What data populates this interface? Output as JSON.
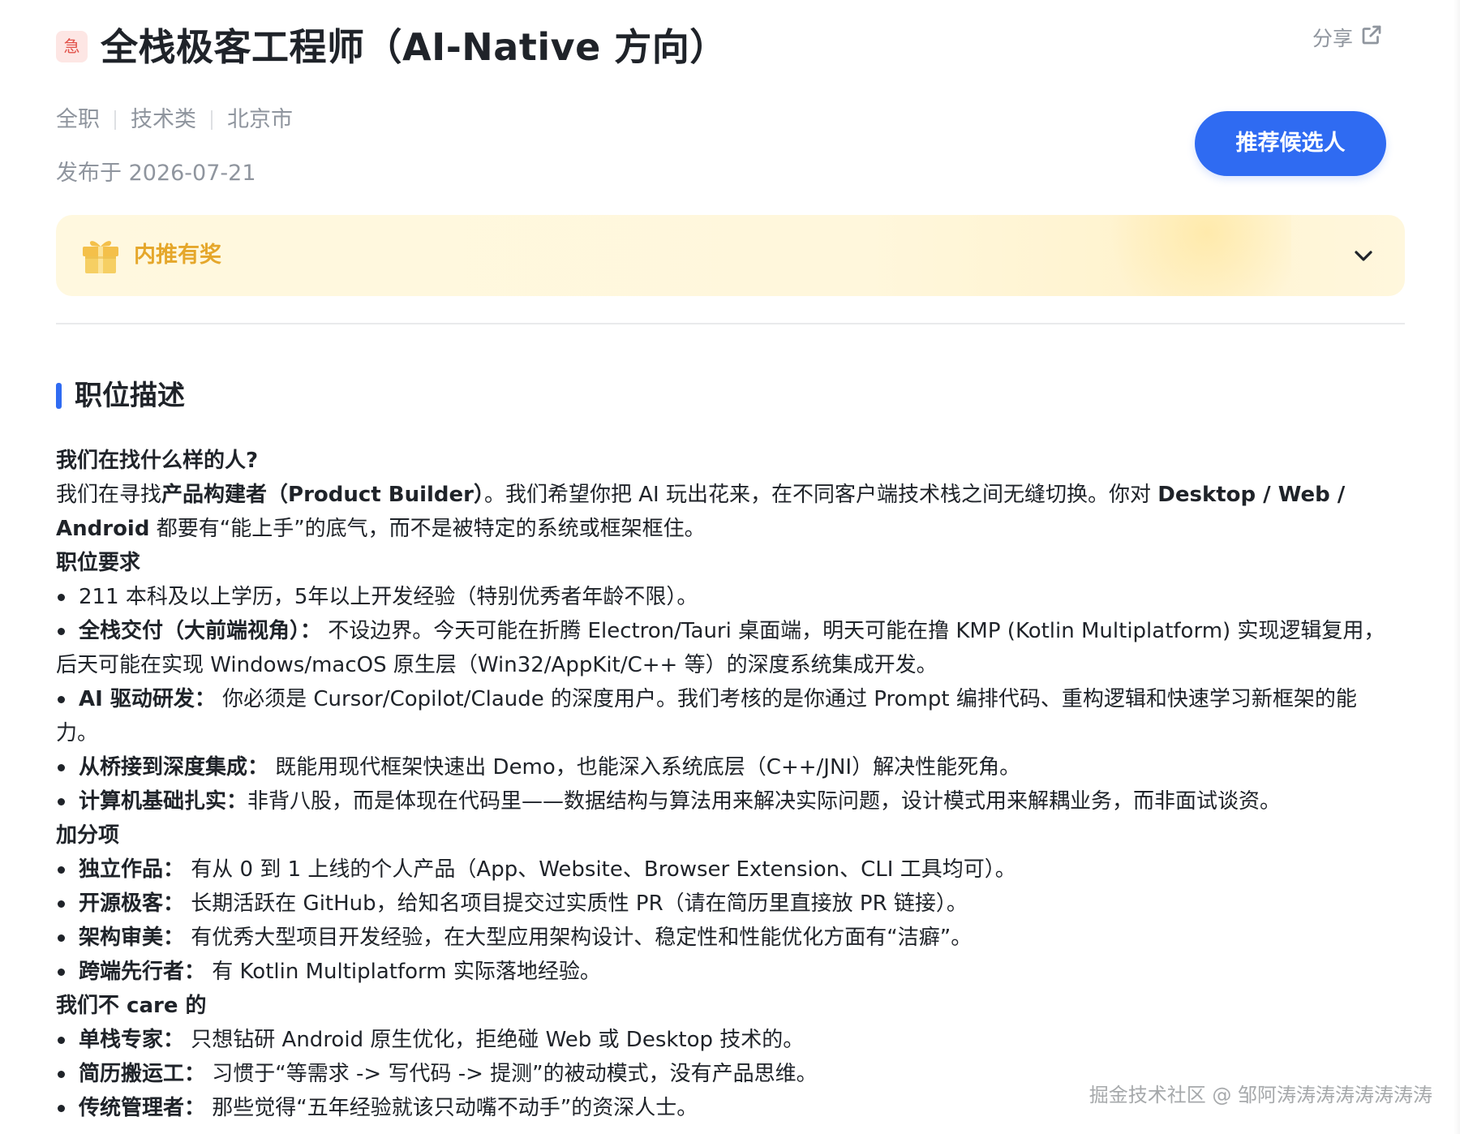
{
  "header": {
    "urgent_badge": "急",
    "title": "全栈极客工程师（AI-Native 方向）",
    "share_label": "分享",
    "share_icon": "share-external-icon",
    "meta": {
      "job_type": "全职",
      "category": "技术类",
      "city": "北京市"
    },
    "published": "发布于 2026-07-21",
    "recommend_button": "推荐候选人"
  },
  "reward": {
    "label": "内推有奖",
    "icon": "gift-icon",
    "expand_icon": "chevron-down-icon"
  },
  "section": {
    "title": "职位描述"
  },
  "description": {
    "who_heading": "我们在找什么样的人?",
    "who_text_1": "我们在寻找",
    "who_bold_1": "产品构建者（Product Builder）",
    "who_text_2": "。我们希望你把 AI 玩出花来，在不同客户端技术栈之间无缝切换。你对 ",
    "who_bold_2": "Desktop / Web / Android",
    "who_text_3": " 都要有“能上手”的底气，而不是被特定的系统或框架框住。",
    "requirements_heading": "职位要求",
    "requirements": [
      {
        "bold": "",
        "text": "211 本科及以上学历，5年以上开发经验（特别优秀者年龄不限）。"
      },
      {
        "bold": "全栈交付（大前端视角）：",
        "text": " 不设边界。今天可能在折腾 Electron/Tauri 桌面端，明天可能在撸 KMP (Kotlin Multiplatform) 实现逻辑复用，后天可能在实现 Windows/macOS 原生层（Win32/AppKit/C++ 等）的深度系统集成开发。"
      },
      {
        "bold": "AI 驱动研发：",
        "text": " 你必须是 Cursor/Copilot/Claude 的深度用户。我们考核的是你通过 Prompt 编排代码、重构逻辑和快速学习新框架的能力。"
      },
      {
        "bold": "从桥接到深度集成：",
        "text": " 既能用现代框架快速出 Demo，也能深入系统底层（C++/JNI）解决性能死角。"
      },
      {
        "bold": "计算机基础扎实：",
        "text": "非背八股，而是体现在代码里——数据结构与算法用来解决实际问题，设计模式用来解耦业务，而非面试谈资。"
      }
    ],
    "bonus_heading": "加分项",
    "bonus": [
      {
        "bold": "独立作品：",
        "text": " 有从 0 到 1 上线的个人产品（App、Website、Browser Extension、CLI 工具均可）。"
      },
      {
        "bold": "开源极客：",
        "text": " 长期活跃在 GitHub，给知名项目提交过实质性 PR（请在简历里直接放 PR 链接）。"
      },
      {
        "bold": "架构审美：",
        "text": " 有优秀大型项目开发经验，在大型应用架构设计、稳定性和性能优化方面有“洁癖”。"
      },
      {
        "bold": "跨端先行者：",
        "text": " 有 Kotlin Multiplatform 实际落地经验。"
      }
    ],
    "not_care_heading": "我们不 care 的",
    "not_care": [
      {
        "bold": "单栈专家：",
        "text": " 只想钻研 Android 原生优化，拒绝碰 Web 或 Desktop 技术的。"
      },
      {
        "bold": "简历搬运工：",
        "text": " 习惯于“等需求 -> 写代码 -> 提测”的被动模式，没有产品思维。"
      },
      {
        "bold": "传统管理者：",
        "text": " 那些觉得“五年经验就该只动嘴不动手”的资深人士。"
      }
    ]
  },
  "watermark": "掘金技术社区 @ 邹阿涛涛涛涛涛涛涛涛",
  "colors": {
    "primary": "#2f6bf2",
    "urgent_bg": "#fde6e4",
    "urgent_text": "#e2524a",
    "reward_bg": "#fff8df",
    "reward_text": "#e5a72b",
    "muted_text": "#8f959e"
  }
}
